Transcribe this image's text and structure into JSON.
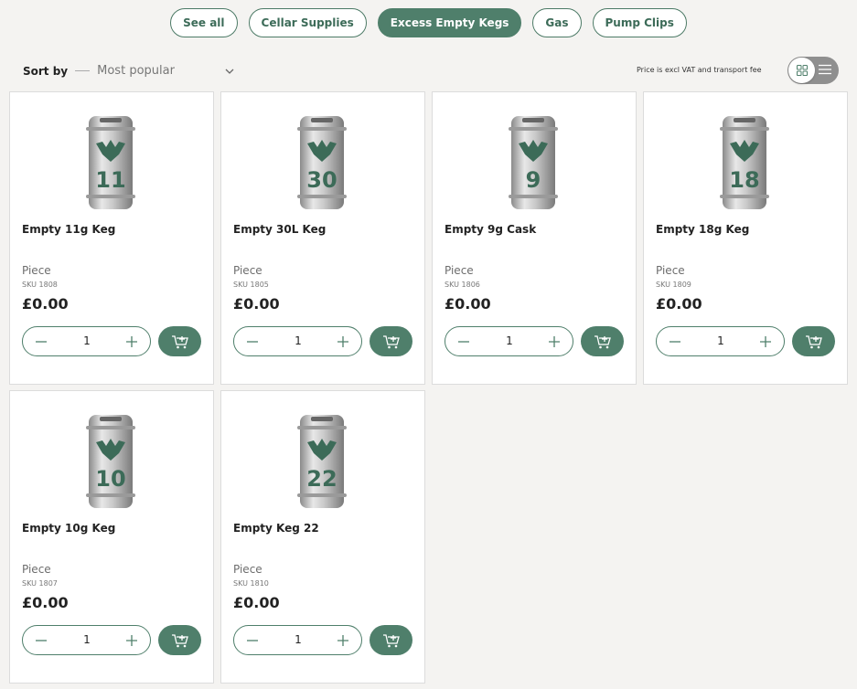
{
  "filters": [
    {
      "label": "See all",
      "active": false
    },
    {
      "label": "Cellar Supplies",
      "active": false
    },
    {
      "label": "Excess Empty Kegs",
      "active": true
    },
    {
      "label": "Gas",
      "active": false
    },
    {
      "label": "Pump Clips",
      "active": false
    }
  ],
  "sort": {
    "label": "Sort by",
    "value": "Most popular"
  },
  "price_note": "Price is excl VAT and transport fee",
  "colors": {
    "brand": "#4f7f6b",
    "background": "#f4f3f1"
  },
  "products": [
    {
      "name": "Empty 11g Keg",
      "keg_number": "11",
      "unit": "Piece",
      "sku": "SKU 1808",
      "price": "£0.00",
      "qty": "1"
    },
    {
      "name": "Empty 30L Keg",
      "keg_number": "30",
      "unit": "Piece",
      "sku": "SKU 1805",
      "price": "£0.00",
      "qty": "1"
    },
    {
      "name": "Empty 9g Cask",
      "keg_number": "9",
      "unit": "Piece",
      "sku": "SKU 1806",
      "price": "£0.00",
      "qty": "1"
    },
    {
      "name": "Empty 18g Keg",
      "keg_number": "18",
      "unit": "Piece",
      "sku": "SKU 1809",
      "price": "£0.00",
      "qty": "1"
    },
    {
      "name": "Empty 10g Keg",
      "keg_number": "10",
      "unit": "Piece",
      "sku": "SKU 1807",
      "price": "£0.00",
      "qty": "1"
    },
    {
      "name": "Empty Keg 22",
      "keg_number": "22",
      "unit": "Piece",
      "sku": "SKU 1810",
      "price": "£0.00",
      "qty": "1"
    }
  ]
}
